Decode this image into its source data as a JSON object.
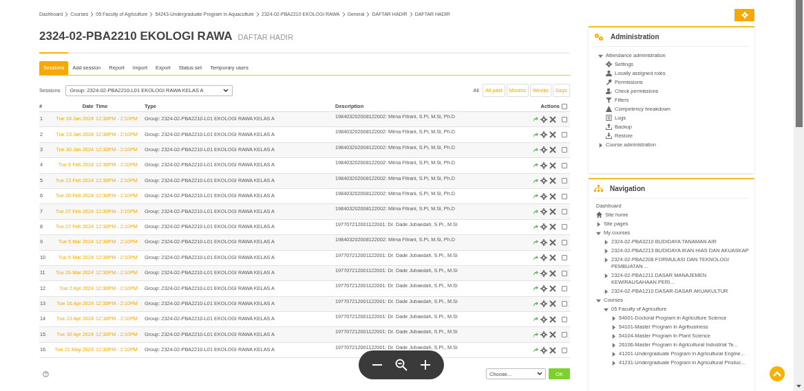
{
  "breadcrumb": [
    "Dashboard",
    "Courses",
    "05 Faculty of Agriculture",
    "54243-Undergraduate Program in Aquaculture",
    "2324-02-PBA2210 EKOLOGI RAWA",
    "General",
    "DAFTAR HADIR",
    "DAFTAR HADIR"
  ],
  "title": "2324-02-PBA2210 EKOLOGI RAWA",
  "subtitle": "DAFTAR HADIR",
  "tabs": [
    {
      "label": "Sessions",
      "selected": true
    },
    {
      "label": "Add session",
      "selected": false
    },
    {
      "label": "Report",
      "selected": false
    },
    {
      "label": "Import",
      "selected": false
    },
    {
      "label": "Export",
      "selected": false
    },
    {
      "label": "Status set",
      "selected": false
    },
    {
      "label": "Temporary users",
      "selected": false
    }
  ],
  "sessions_label": "Sessions",
  "group_select": "Group: 2324-02-PBA2210-L01 EKOLOGI RAWA KELAS A",
  "periods": [
    {
      "label": "All",
      "selected": true
    },
    {
      "label": "All past",
      "selected": false
    },
    {
      "label": "Months",
      "selected": false
    },
    {
      "label": "Weeks",
      "selected": false
    },
    {
      "label": "Days",
      "selected": false
    }
  ],
  "columns": [
    "#",
    "Date",
    "Time",
    "Type",
    "Description",
    "Actions"
  ],
  "select_all_checked": false,
  "rows": [
    {
      "n": "1",
      "date": "Tue 16 Jan 2024",
      "time": "12:30PM - 2:10PM",
      "type": "Group: 2324-02-PBA2210-L01 EKOLOGI RAWA KELAS A",
      "description": "198403202008122002: Mirna Fitrani, S.Pi, M.Si, Ph.D",
      "checked": false
    },
    {
      "n": "2",
      "date": "Tue 23 Jan 2024",
      "time": "12:30PM - 2:10PM",
      "type": "Group: 2324-02-PBA2210-L01 EKOLOGI RAWA KELAS A",
      "description": "198403202008122002: Mirna Fitrani, S.Pi, M.Si, Ph.D",
      "checked": false
    },
    {
      "n": "3",
      "date": "Tue 30 Jan 2024",
      "time": "12:30PM - 2:10PM",
      "type": "Group: 2324-02-PBA2210-L01 EKOLOGI RAWA KELAS A",
      "description": "198403202008122002: Mirna Fitrani, S.Pi, M.Si, Ph.D",
      "checked": false
    },
    {
      "n": "4",
      "date": "Tue 6 Feb 2024",
      "time": "12:30PM - 2:10PM",
      "type": "Group: 2324-02-PBA2210-L01 EKOLOGI RAWA KELAS A",
      "description": "198403202008122002: Mirna Fitrani, S.Pi, M.Si, Ph.D",
      "checked": false
    },
    {
      "n": "5",
      "date": "Tue 13 Feb 2024",
      "time": "12:30PM - 2:10PM",
      "type": "Group: 2324-02-PBA2210-L01 EKOLOGI RAWA KELAS A",
      "description": "198403202008122002: Mirna Fitrani, S.Pi, M.Si, Ph.D",
      "checked": false
    },
    {
      "n": "6",
      "date": "Tue 20 Feb 2024",
      "time": "12:30PM - 2:10PM",
      "type": "Group: 2324-02-PBA2210-L01 EKOLOGI RAWA KELAS A",
      "description": "198403202008122002: Mirna Fitrani, S.Pi, M.Si, Ph.D",
      "checked": false
    },
    {
      "n": "7",
      "date": "Tue 27 Feb 2024",
      "time": "12:30PM - 2:10PM",
      "type": "Group: 2324-02-PBA2210-L01 EKOLOGI RAWA KELAS A",
      "description": "198403202008122002: Mirna Fitrani, S.Pi, M.Si, Ph.D",
      "checked": false
    },
    {
      "n": "8",
      "date": "Tue 27 Feb 2024",
      "time": "12:30PM - 2:10PM",
      "type": "Group: 2324-02-PBA2210-L01 EKOLOGI RAWA KELAS A",
      "description": "197707212001122001: Dr. Dade Jubaedah, S.Pi., M.Si",
      "checked": false
    },
    {
      "n": "9",
      "date": "Tue 5 Mar 2024",
      "time": "12:30PM - 2:10PM",
      "type": "Group: 2324-02-PBA2210-L01 EKOLOGI RAWA KELAS A",
      "description": "198403202008122002: Mirna Fitrani, S.Pi, M.Si, Ph.D",
      "checked": false
    },
    {
      "n": "10",
      "date": "Tue 5 Mar 2024",
      "time": "12:30PM - 2:10PM",
      "type": "Group: 2324-02-PBA2210-L01 EKOLOGI RAWA KELAS A",
      "description": "197707212001122001: Dr. Dade Jubaedah, S.Pi., M.Si",
      "checked": false
    },
    {
      "n": "11",
      "date": "Tue 26 Mar 2024",
      "time": "12:30PM - 2:10PM",
      "type": "Group: 2324-02-PBA2210-L01 EKOLOGI RAWA KELAS A",
      "description": "197707212001122001: Dr. Dade Jubaedah, S.Pi., M.Si",
      "checked": false
    },
    {
      "n": "12",
      "date": "Tue 2 Apr 2024",
      "time": "12:30PM - 2:10PM",
      "type": "Group: 2324-02-PBA2210-L01 EKOLOGI RAWA KELAS A",
      "description": "197707212001122001: Dr. Dade Jubaedah, S.Pi., M.Si",
      "checked": false
    },
    {
      "n": "13",
      "date": "Tue 16 Apr 2024",
      "time": "12:30PM - 2:10PM",
      "type": "Group: 2324-02-PBA2210-L01 EKOLOGI RAWA KELAS A",
      "description": "197707212001122001: Dr. Dade Jubaedah, S.Pi., M.Si",
      "checked": false
    },
    {
      "n": "14",
      "date": "Tue 23 Apr 2024",
      "time": "12:30PM - 2:10PM",
      "type": "Group: 2324-02-PBA2210-L01 EKOLOGI RAWA KELAS A",
      "description": "197707212001122001: Dr. Dade Jubaedah, S.Pi., M.Si",
      "checked": false
    },
    {
      "n": "15",
      "date": "Tue 30 Apr 2024",
      "time": "12:30PM - 2:10PM",
      "type": "Group: 2324-02-PBA2210-L01 EKOLOGI RAWA KELAS A",
      "description": "197707212001122001: Dr. Dade Jubaedah, S.Pi., M.Si",
      "checked": false
    },
    {
      "n": "16",
      "date": "Tue 21 May 2024",
      "time": "12:30PM - 2:10PM",
      "type": "Group: 2324-02-PBA2210-L01 EKOLOGI RAWA KELAS A",
      "description": "197707212001122001: Dr. Dade Jubaedah, S.Pi., M.Si",
      "checked": false
    }
  ],
  "bulk_select": "Choose...",
  "ok_button": "OK",
  "administration": {
    "title": "Administration",
    "items": [
      {
        "label": "Attendance administration",
        "kind": "branch",
        "expanded": true,
        "children": [
          {
            "label": "Settings",
            "kind": "settings"
          },
          {
            "label": "Locally assigned roles",
            "kind": "roles"
          },
          {
            "label": "Permissions",
            "kind": "permissions"
          },
          {
            "label": "Check permissions",
            "kind": "check"
          },
          {
            "label": "Filters",
            "kind": "filters"
          },
          {
            "label": "Competency breakdown",
            "kind": "competency"
          },
          {
            "label": "Logs",
            "kind": "logs"
          },
          {
            "label": "Backup",
            "kind": "backup"
          },
          {
            "label": "Restore",
            "kind": "restore"
          }
        ]
      },
      {
        "label": "Course administration",
        "kind": "branch",
        "expanded": false
      }
    ]
  },
  "navigation": {
    "title": "Navigation",
    "items": [
      {
        "label": "Dashboard",
        "kind": "plain"
      },
      {
        "label": "Site home",
        "kind": "home"
      },
      {
        "label": "Site pages",
        "kind": "branch",
        "expanded": false
      },
      {
        "label": "My courses",
        "kind": "branch",
        "expanded": true,
        "children": [
          {
            "label": "2324-02-PBA3210 BUDIDAYA TANAMAN AIR",
            "kind": "branch",
            "expanded": false
          },
          {
            "label": "2324-02-PBA2213 BUDIDAYA IKAN HIAS DAN AKUASKAP",
            "kind": "branch",
            "expanded": false
          },
          {
            "label": "2324-02-PBA2208 FORMULASI DAN TEKNOLOGI PEMBUATAN ...",
            "kind": "branch",
            "expanded": false
          },
          {
            "label": "2324-02-PBA1211 DASAR MANAJEMEN KEWIRAUSAHAAN PERI...",
            "kind": "branch",
            "expanded": false
          },
          {
            "label": "2324-02-PBA1210 DASAR-DASAR AKUAKULTUR",
            "kind": "branch",
            "expanded": false
          }
        ]
      },
      {
        "label": "Courses",
        "kind": "branch",
        "expanded": true,
        "children": [
          {
            "label": "05 Faculty of Agriculture",
            "kind": "branch",
            "expanded": true,
            "children": [
              {
                "label": "54001-Doctoral Program in Agriculture Science",
                "kind": "branch",
                "expanded": false
              },
              {
                "label": "54101-Master Program in Agribusiness",
                "kind": "branch",
                "expanded": false
              },
              {
                "label": "54104-Master Program in Plant Science",
                "kind": "branch",
                "expanded": false
              },
              {
                "label": "26106-Master Program in Agricultural Industrial Te...",
                "kind": "branch",
                "expanded": false
              },
              {
                "label": "41201-Undergraduate Program in Agricultural Engine...",
                "kind": "branch",
                "expanded": false
              },
              {
                "label": "41231-Undergraduate Program in Agricultural Produc...",
                "kind": "branch",
                "expanded": false
              }
            ]
          }
        ]
      }
    ]
  }
}
